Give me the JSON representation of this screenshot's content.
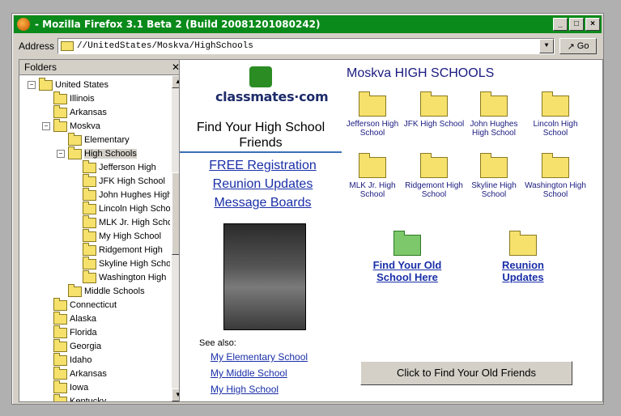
{
  "window": {
    "title": "- Mozilla Firefox 3.1 Beta 2 (Build 20081201080242)"
  },
  "address": {
    "label": "Address",
    "value": "//UnitedStates/Moskva/HighSchools",
    "go": "Go"
  },
  "folders": {
    "title": "Folders",
    "close": "✕"
  },
  "tree": [
    {
      "label": "United States",
      "indent": 0,
      "exp": "−"
    },
    {
      "label": "Illinois",
      "indent": 1
    },
    {
      "label": "Arkansas",
      "indent": 1
    },
    {
      "label": "Moskva",
      "indent": 1,
      "exp": "−"
    },
    {
      "label": "Elementary",
      "indent": 2
    },
    {
      "label": "High Schools",
      "indent": 2,
      "exp": "−",
      "selected": true
    },
    {
      "label": "Jefferson High",
      "indent": 3
    },
    {
      "label": "JFK High School",
      "indent": 3
    },
    {
      "label": "John Hughes High",
      "indent": 3
    },
    {
      "label": "Lincoln High School",
      "indent": 3
    },
    {
      "label": "MLK Jr. High School",
      "indent": 3
    },
    {
      "label": "My High School",
      "indent": 3
    },
    {
      "label": "Ridgemont High",
      "indent": 3
    },
    {
      "label": "Skyline High School",
      "indent": 3
    },
    {
      "label": "Washington High",
      "indent": 3
    },
    {
      "label": "Middle Schools",
      "indent": 2
    },
    {
      "label": "Connecticut",
      "indent": 1
    },
    {
      "label": "Alaska",
      "indent": 1
    },
    {
      "label": "Florida",
      "indent": 1
    },
    {
      "label": "Georgia",
      "indent": 1
    },
    {
      "label": "Idaho",
      "indent": 1
    },
    {
      "label": "Arkansas",
      "indent": 1
    },
    {
      "label": "Iowa",
      "indent": 1
    },
    {
      "label": "Kentucky",
      "indent": 1
    }
  ],
  "content": {
    "logo": "classmates·com",
    "find_title": "Find Your High School Friends",
    "links": [
      "FREE Registration",
      "Reunion Updates",
      "Message Boards"
    ],
    "see_also": "See also:",
    "small_links": [
      "My Elementary School",
      "My Middle School",
      "My High School"
    ],
    "page_title": "Moskva HIGH SCHOOLS",
    "schools": [
      "Jefferson High School",
      "JFK High School",
      "John Hughes High School",
      "Lincoln High School",
      "MLK Jr. High School",
      "Ridgemont High School",
      "Skyline High School",
      "Washington High School"
    ],
    "actions": [
      "Find Your Old School Here",
      "Reunion Updates"
    ],
    "button": "Click to Find Your Old Friends"
  }
}
